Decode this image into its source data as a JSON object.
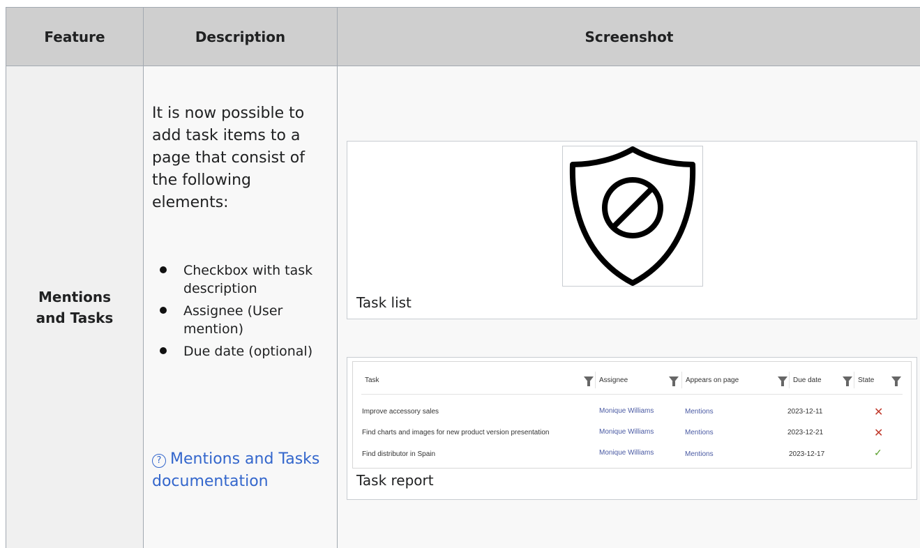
{
  "headers": {
    "feature": "Feature",
    "description": "Description",
    "screenshot": "Screenshot"
  },
  "row": {
    "feature": "Mentions and Tasks",
    "description": "It is now possible to add task items to a page that consist of the following elements:",
    "bullets": [
      "Checkbox with task description",
      "Assignee (User mention)",
      "Due date (optional)"
    ],
    "help_link": "Mentions and Tasks documentation",
    "help_icon": "question-circle-icon"
  },
  "figure1": {
    "caption": "Task list",
    "image_icon": "shield-forbidden-icon"
  },
  "figure2": {
    "caption": "Task report",
    "columns": [
      "Task",
      "Assignee",
      "Appears on page",
      "Due date",
      "State"
    ],
    "rows": [
      {
        "task": "Improve accessory sales",
        "assignee": "Monique Williams",
        "page": "Mentions",
        "due": "2023-12-11",
        "state": "open"
      },
      {
        "task": "Find charts and images for new product version presentation",
        "assignee": "Monique Williams",
        "page": "Mentions",
        "due": "2023-12-21",
        "state": "open"
      },
      {
        "task": "Find distributor in Spain",
        "assignee": "Monique Williams",
        "page": "Mentions",
        "due": "2023-12-17",
        "state": "done"
      }
    ],
    "state_icons": {
      "open": "cross-icon",
      "done": "checkmark-icon"
    },
    "colors": {
      "link": "#4a5aa3",
      "open": "#c0392b",
      "done": "#5aa02c"
    }
  }
}
